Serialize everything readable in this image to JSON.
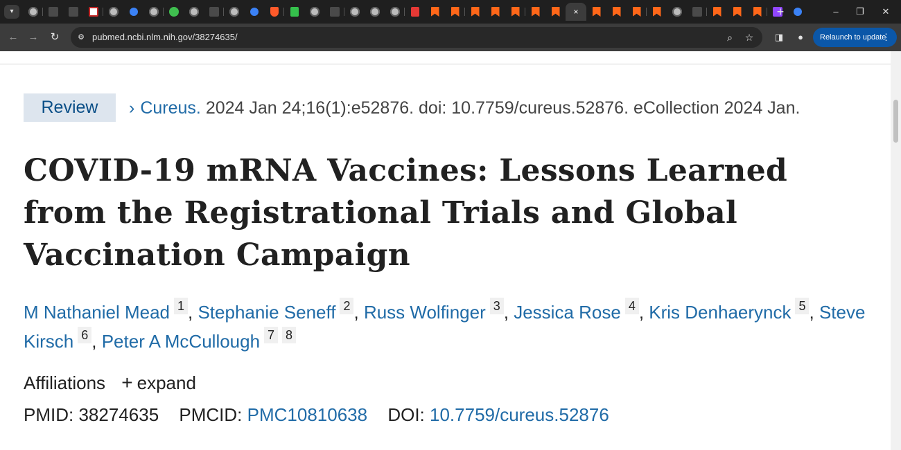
{
  "browser": {
    "url": "pubmed.ncbi.nlm.nih.gov/38274635/",
    "relaunch_label": "Relaunch to update",
    "active_tab_close": "×",
    "new_tab": "+",
    "tab_favicons": [
      "globe",
      "shield-blue",
      "bookmark-blue",
      "bi-logo",
      "globe",
      "search",
      "globe",
      "play",
      "globe",
      "shield-blue",
      "globe",
      "cube",
      "shield-orange",
      "green-g",
      "globe",
      "text-wiki",
      "globe",
      "globe",
      "globe",
      "red-logo",
      "substack",
      "substack",
      "substack",
      "substack",
      "substack",
      "substack",
      "substack",
      "active",
      "substack",
      "substack",
      "substack",
      "substack",
      "globe",
      "text-wiki",
      "substack",
      "substack",
      "substack",
      "twitch",
      "search"
    ],
    "window_controls": {
      "minimize": "–",
      "maximize": "❐",
      "close": "✕"
    }
  },
  "article": {
    "badge": "Review",
    "journal": "Cureus.",
    "citation_rest": "2024 Jan 24;16(1):e52876. doi: 10.7759/cureus.52876. eCollection 2024 Jan.",
    "title": "COVID-19 mRNA Vaccines: Lessons Learned from the Registrational Trials and Global Vaccination Campaign",
    "authors": [
      {
        "name": "M Nathaniel Mead",
        "refs": [
          "1"
        ]
      },
      {
        "name": "Stephanie Seneff",
        "refs": [
          "2"
        ]
      },
      {
        "name": "Russ Wolfinger",
        "refs": [
          "3"
        ]
      },
      {
        "name": "Jessica Rose",
        "refs": [
          "4"
        ]
      },
      {
        "name": "Kris Denhaerynck",
        "refs": [
          "5"
        ]
      },
      {
        "name": "Steve Kirsch",
        "refs": [
          "6"
        ]
      },
      {
        "name": "Peter A McCullough",
        "refs": [
          "7",
          "8"
        ]
      }
    ],
    "affiliations_label": "Affiliations",
    "expand_label": "expand",
    "pmid_label": "PMID:",
    "pmid": "38274635",
    "pmcid_label": "PMCID:",
    "pmcid": "PMC10810638",
    "doi_label": "DOI:",
    "doi": "10.7759/cureus.52876"
  }
}
